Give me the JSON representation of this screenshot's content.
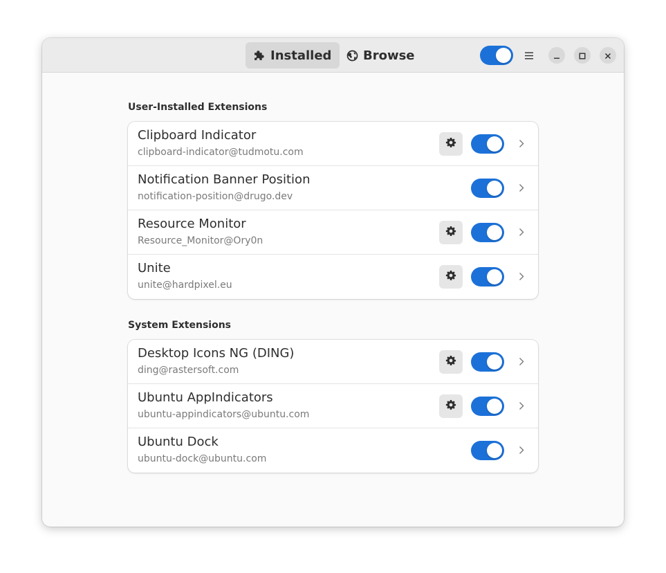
{
  "tabs": [
    {
      "label": "Installed",
      "icon": "puzzle-piece-icon",
      "active": true
    },
    {
      "label": "Browse",
      "icon": "globe-icon",
      "active": false
    }
  ],
  "header": {
    "extensions_enabled": true,
    "menu_icon": "hamburger-menu-icon"
  },
  "window_controls": [
    "minimize-icon",
    "maximize-icon",
    "close-icon"
  ],
  "colors": {
    "accent": "#1c71d8",
    "headerbar": "#ebebeb",
    "background": "#fafafa"
  },
  "sections": [
    {
      "title": "User-Installed Extensions",
      "items": [
        {
          "name": "Clipboard Indicator",
          "uuid": "clipboard-indicator@tudmotu.com",
          "has_settings": true,
          "enabled": true
        },
        {
          "name": "Notification Banner Position",
          "uuid": "notification-position@drugo.dev",
          "has_settings": false,
          "enabled": true
        },
        {
          "name": "Resource Monitor",
          "uuid": "Resource_Monitor@Ory0n",
          "has_settings": true,
          "enabled": true
        },
        {
          "name": "Unite",
          "uuid": "unite@hardpixel.eu",
          "has_settings": true,
          "enabled": true
        }
      ]
    },
    {
      "title": "System Extensions",
      "items": [
        {
          "name": "Desktop Icons NG (DING)",
          "uuid": "ding@rastersoft.com",
          "has_settings": true,
          "enabled": true
        },
        {
          "name": "Ubuntu AppIndicators",
          "uuid": "ubuntu-appindicators@ubuntu.com",
          "has_settings": true,
          "enabled": true
        },
        {
          "name": "Ubuntu Dock",
          "uuid": "ubuntu-dock@ubuntu.com",
          "has_settings": false,
          "enabled": true
        }
      ]
    }
  ]
}
